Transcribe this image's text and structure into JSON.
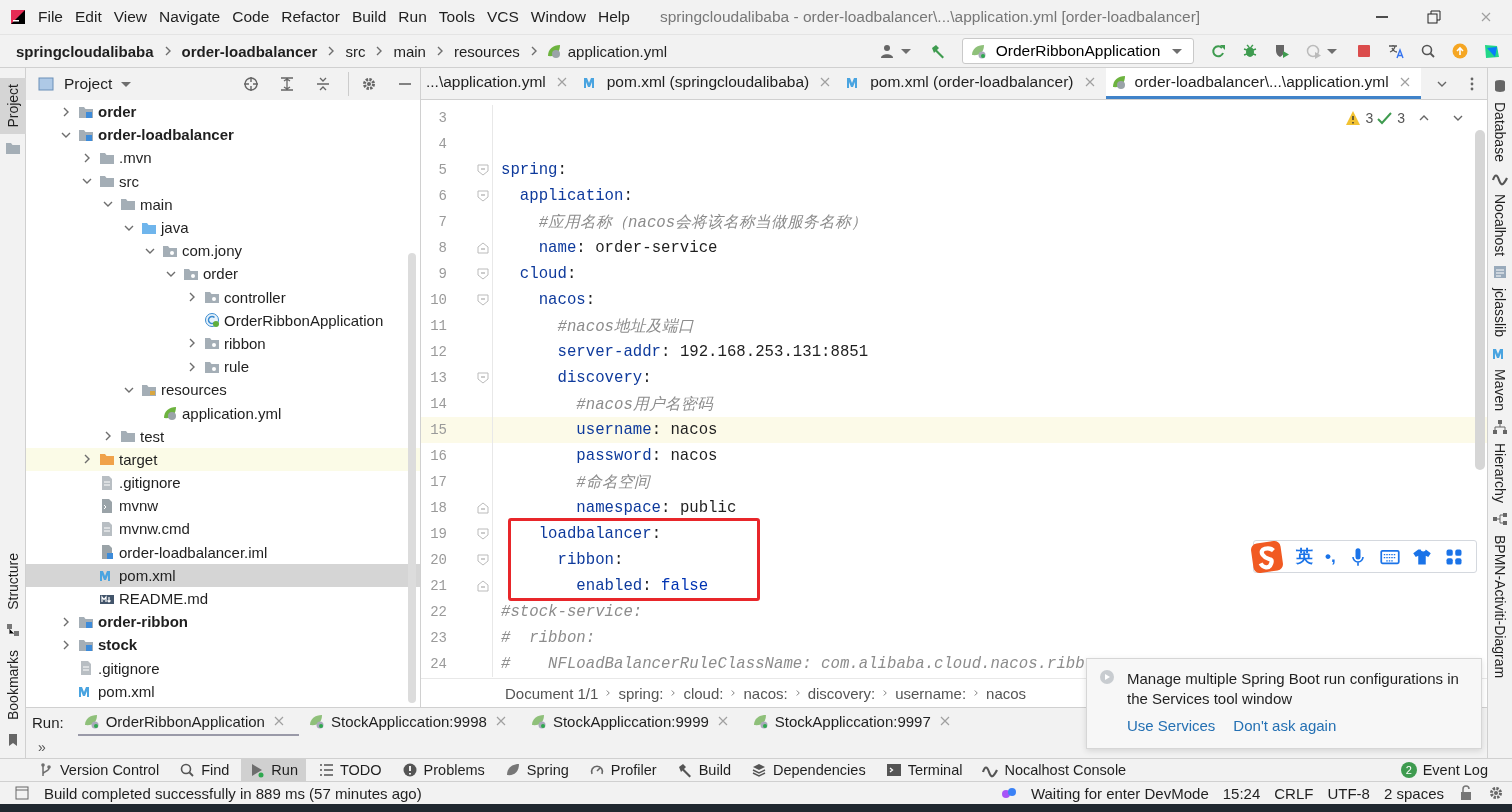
{
  "title_bar": {
    "menu": [
      "File",
      "Edit",
      "View",
      "Navigate",
      "Code",
      "Refactor",
      "Build",
      "Run",
      "Tools",
      "VCS",
      "Window",
      "Help"
    ],
    "title": "springcloudalibaba - order-loadbalancer\\...\\application.yml [order-loadbalancer]"
  },
  "navigation": {
    "breadcrumbs": [
      {
        "label": "springcloudalibaba",
        "kind": "project"
      },
      {
        "label": "order-loadbalancer",
        "kind": "module"
      },
      {
        "label": "src",
        "kind": "folder"
      },
      {
        "label": "main",
        "kind": "folder"
      },
      {
        "label": "resources",
        "kind": "folder"
      },
      {
        "label": "application.yml",
        "kind": "yml"
      }
    ],
    "run_configuration": "OrderRibbonApplication"
  },
  "left_stripe": [
    {
      "label": "Project",
      "kind": "project",
      "selected": true
    },
    {
      "label": "Structure",
      "kind": "structure",
      "selected": false
    },
    {
      "label": "Bookmarks",
      "kind": "bookmarks",
      "selected": false
    }
  ],
  "project": {
    "title": "Project",
    "tree": [
      {
        "label": "order",
        "kind": "module",
        "expanded": false,
        "selected": false
      },
      {
        "label": "order-loadbalancer",
        "kind": "module",
        "expanded": true,
        "selected": false,
        "children": [
          {
            "label": ".mvn",
            "kind": "folder",
            "expanded": false,
            "selected": false
          },
          {
            "label": "src",
            "kind": "folder",
            "expanded": true,
            "selected": false,
            "children": [
              {
                "label": "main",
                "kind": "folder",
                "expanded": true,
                "selected": false,
                "children": [
                  {
                    "label": "java",
                    "kind": "source-folder",
                    "expanded": true,
                    "selected": false,
                    "children": [
                      {
                        "label": "com.jony",
                        "kind": "package",
                        "expanded": true,
                        "selected": false,
                        "children": [
                          {
                            "label": "order",
                            "kind": "package",
                            "expanded": true,
                            "selected": false,
                            "children": [
                              {
                                "label": "controller",
                                "kind": "package",
                                "expanded": false,
                                "selected": false
                              },
                              {
                                "label": "OrderRibbonApplication",
                                "kind": "spring-class",
                                "selected": false
                              },
                              {
                                "label": "ribbon",
                                "kind": "package",
                                "expanded": false,
                                "selected": false
                              },
                              {
                                "label": "rule",
                                "kind": "package",
                                "expanded": false,
                                "selected": false
                              }
                            ]
                          }
                        ]
                      }
                    ]
                  },
                  {
                    "label": "resources",
                    "kind": "resources-folder",
                    "expanded": true,
                    "selected": false,
                    "children": [
                      {
                        "label": "application.yml",
                        "kind": "yml",
                        "selected": false
                      }
                    ]
                  }
                ]
              },
              {
                "label": "test",
                "kind": "folder",
                "expanded": false,
                "selected": false
              }
            ]
          },
          {
            "label": "target",
            "kind": "excluded-folder",
            "expanded": false,
            "selected": false
          },
          {
            "label": ".gitignore",
            "kind": "file",
            "selected": false
          },
          {
            "label": "mvnw",
            "kind": "script",
            "selected": false
          },
          {
            "label": "mvnw.cmd",
            "kind": "file",
            "selected": false
          },
          {
            "label": "order-loadbalancer.iml",
            "kind": "iml",
            "selected": false
          },
          {
            "label": "pom.xml",
            "kind": "maven",
            "selected": true
          },
          {
            "label": "README.md",
            "kind": "markdown",
            "selected": false
          }
        ]
      },
      {
        "label": "order-ribbon",
        "kind": "module",
        "expanded": false,
        "selected": false
      },
      {
        "label": "stock",
        "kind": "module",
        "expanded": false,
        "selected": false
      },
      {
        "label": ".gitignore",
        "kind": "file",
        "selected": false
      },
      {
        "label": "pom.xml",
        "kind": "maven",
        "selected": false
      }
    ]
  },
  "editor": {
    "tabs": [
      {
        "label": "...\\application.yml",
        "selected": false
      },
      {
        "label": "pom.xml (springcloudalibaba)",
        "kind": "maven",
        "selected": false
      },
      {
        "label": "pom.xml (order-loadbalancer)",
        "kind": "maven",
        "selected": false
      },
      {
        "label": "order-loadbalancer\\...\\application.yml",
        "kind": "yml",
        "selected": true
      }
    ],
    "warnings": "3",
    "checks": "3",
    "lines": [
      {
        "number": "3",
        "current": false,
        "framed": false
      },
      {
        "number": "4",
        "current": false,
        "framed": false
      },
      {
        "number": "5",
        "fold_start": true,
        "current": false,
        "framed": false,
        "tokens": [
          {
            "kind": "key",
            "text": "spring"
          },
          {
            "kind": "punct",
            "text": ":"
          }
        ]
      },
      {
        "number": "6",
        "fold_start": true,
        "current": false,
        "framed": false,
        "tokens": [
          {
            "kind": "key",
            "text": "  application"
          },
          {
            "kind": "punct",
            "text": ":"
          }
        ]
      },
      {
        "number": "7",
        "current": false,
        "framed": false,
        "tokens": [
          {
            "kind": "comment",
            "text": "    #应用名称（nacos会将该名称当做服务名称）"
          }
        ]
      },
      {
        "number": "8",
        "fold_end": true,
        "current": false,
        "framed": false,
        "tokens": [
          {
            "kind": "key",
            "text": "    name"
          },
          {
            "kind": "punct",
            "text": ":"
          },
          {
            "kind": "value",
            "text": " order-service"
          }
        ]
      },
      {
        "number": "9",
        "fold_start": true,
        "current": false,
        "framed": false,
        "tokens": [
          {
            "kind": "key",
            "text": "  cloud"
          },
          {
            "kind": "punct",
            "text": ":"
          }
        ]
      },
      {
        "number": "10",
        "fold_start": true,
        "current": false,
        "framed": false,
        "tokens": [
          {
            "kind": "key",
            "text": "    nacos"
          },
          {
            "kind": "punct",
            "text": ":"
          }
        ]
      },
      {
        "number": "11",
        "current": false,
        "framed": false,
        "tokens": [
          {
            "kind": "comment",
            "text": "      #nacos地址及端口"
          }
        ]
      },
      {
        "number": "12",
        "current": false,
        "framed": false,
        "tokens": [
          {
            "kind": "key",
            "text": "      server-addr"
          },
          {
            "kind": "punct",
            "text": ":"
          },
          {
            "kind": "value",
            "text": " 192.168.253.131:8851"
          }
        ]
      },
      {
        "number": "13",
        "fold_start": true,
        "current": false,
        "framed": false,
        "tokens": [
          {
            "kind": "key",
            "text": "      discovery"
          },
          {
            "kind": "punct",
            "text": ":"
          }
        ]
      },
      {
        "number": "14",
        "current": false,
        "framed": false,
        "tokens": [
          {
            "kind": "comment",
            "text": "        #nacos用户名密码"
          }
        ]
      },
      {
        "number": "15",
        "current": true,
        "framed": false,
        "tokens": [
          {
            "kind": "key",
            "text": "        username"
          },
          {
            "kind": "punct",
            "text": ":"
          },
          {
            "kind": "value",
            "text": " nacos"
          }
        ]
      },
      {
        "number": "16",
        "current": false,
        "framed": false,
        "tokens": [
          {
            "kind": "key",
            "text": "        password"
          },
          {
            "kind": "punct",
            "text": ":"
          },
          {
            "kind": "value",
            "text": " nacos"
          }
        ]
      },
      {
        "number": "17",
        "current": false,
        "framed": false,
        "tokens": [
          {
            "kind": "comment",
            "text": "        #命名空间"
          }
        ]
      },
      {
        "number": "18",
        "fold_end": true,
        "current": false,
        "framed": false,
        "tokens": [
          {
            "kind": "key",
            "text": "        namespace"
          },
          {
            "kind": "punct",
            "text": ":"
          },
          {
            "kind": "value",
            "text": " public"
          }
        ]
      },
      {
        "number": "19",
        "fold_start": true,
        "current": false,
        "framed": true,
        "tokens": [
          {
            "kind": "key",
            "text": "    loadbalancer"
          },
          {
            "kind": "punct",
            "text": ":"
          }
        ]
      },
      {
        "number": "20",
        "fold_start": true,
        "current": false,
        "framed": true,
        "tokens": [
          {
            "kind": "key",
            "text": "      ribbon"
          },
          {
            "kind": "punct",
            "text": ":"
          }
        ]
      },
      {
        "number": "21",
        "fold_end": true,
        "current": false,
        "framed": true,
        "tokens": [
          {
            "kind": "key",
            "text": "        enabled"
          },
          {
            "kind": "punct",
            "text": ":"
          },
          {
            "kind": "keyword",
            "text": " false"
          }
        ]
      },
      {
        "number": "22",
        "current": false,
        "framed": false,
        "tokens": [
          {
            "kind": "comment",
            "text": "#stock-service:"
          }
        ]
      },
      {
        "number": "23",
        "current": false,
        "framed": false,
        "tokens": [
          {
            "kind": "comment",
            "text": "#  ribbon:"
          }
        ]
      },
      {
        "number": "24",
        "current": false,
        "framed": false,
        "tokens": [
          {
            "kind": "comment",
            "text": "#    NFLoadBalancerRuleClassName: com.alibaba.cloud.nacos.ribb"
          }
        ]
      }
    ],
    "breadcrumbs": [
      "Document 1/1",
      "spring:",
      "cloud:",
      "nacos:",
      "discovery:",
      "username:",
      "nacos"
    ]
  },
  "right_stripe": [
    {
      "label": "Database",
      "kind": "database"
    },
    {
      "label": "Nocalhost",
      "kind": "nocalhost"
    },
    {
      "label": "jclasslib",
      "kind": "jclasslib"
    },
    {
      "label": "Maven",
      "kind": "maven"
    },
    {
      "label": "Hierarchy",
      "kind": "hierarchy"
    },
    {
      "label": "BPMN-Activiti-Diagram",
      "kind": "bpmn"
    }
  ],
  "ime": {
    "language": "英",
    "punctuation": "•,"
  },
  "notification": {
    "message": "Manage multiple Spring Boot run configurations in the Services tool window",
    "actions": [
      "Use Services",
      "Don't ask again"
    ]
  },
  "run_panel": {
    "label": "Run:",
    "more": "»",
    "tabs": [
      {
        "label": "OrderRibbonApplication",
        "selected": true
      },
      {
        "label": "StockAppliccation:9998",
        "selected": false
      },
      {
        "label": "StockAppliccation:9999",
        "selected": false
      },
      {
        "label": "StockAppliccation:9997",
        "selected": false
      }
    ]
  },
  "tool_windows": [
    {
      "label": "Version Control",
      "kind": "vcs",
      "selected": false
    },
    {
      "label": "Find",
      "kind": "find",
      "selected": false
    },
    {
      "label": "Run",
      "kind": "run",
      "selected": true
    },
    {
      "label": "TODO",
      "kind": "todo",
      "selected": false
    },
    {
      "label": "Problems",
      "kind": "problems",
      "selected": false
    },
    {
      "label": "Spring",
      "kind": "spring",
      "selected": false
    },
    {
      "label": "Profiler",
      "kind": "profiler",
      "selected": false
    },
    {
      "label": "Build",
      "kind": "build",
      "selected": false
    },
    {
      "label": "Dependencies",
      "kind": "dependencies",
      "selected": false
    },
    {
      "label": "Terminal",
      "kind": "terminal",
      "selected": false
    },
    {
      "label": "Nocalhost Console",
      "kind": "nocalhost",
      "selected": false
    },
    {
      "label": "Event Log",
      "badge": "2",
      "selected": false
    }
  ],
  "status_bar": {
    "message": "Build completed successfully in 889 ms (57 minutes ago)",
    "devmode": "Waiting for enter DevMode",
    "position": "15:24",
    "line_separator": "CRLF",
    "encoding": "UTF-8",
    "indent": "2 spaces"
  }
}
